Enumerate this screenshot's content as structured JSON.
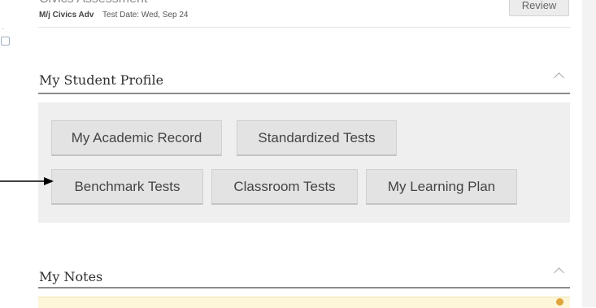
{
  "previous_item": {
    "partial_title": "Civics Assessment",
    "course": "M/j Civics Adv",
    "test_date": "Test Date: Wed, Sep 24",
    "review_label": "Review"
  },
  "profile": {
    "title": "My Student Profile",
    "buttons": {
      "academic_record": "My Academic Record",
      "standardized_tests": "Standardized Tests",
      "benchmark_tests": "Benchmark Tests",
      "classroom_tests": "Classroom Tests",
      "learning_plan": "My Learning Plan"
    }
  },
  "notes": {
    "title": "My Notes"
  },
  "colors": {
    "panel": "#efefef",
    "button": "#e3e3e3",
    "notes_banner": "#fdf6d8",
    "notes_badge": "#e0a43a"
  }
}
